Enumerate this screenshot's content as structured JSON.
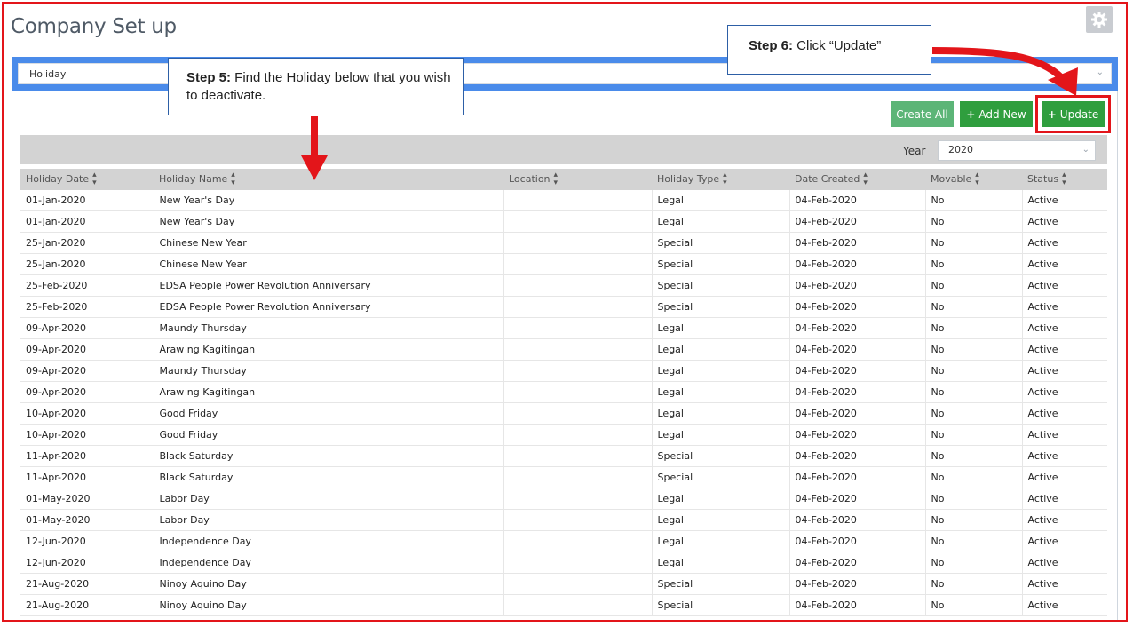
{
  "page": {
    "title": "Company Set up"
  },
  "module_select": {
    "value": "Holiday"
  },
  "toolbar": {
    "create_all": "Create All",
    "add_new": "Add New",
    "update": "Update"
  },
  "filter": {
    "year_label": "Year",
    "year_value": "2020"
  },
  "table": {
    "headers": [
      "Holiday Date",
      "Holiday Name",
      "Location",
      "Holiday Type",
      "Date Created",
      "Movable",
      "Status"
    ],
    "rows": [
      [
        "01-Jan-2020",
        "New Year's Day",
        "",
        "Legal",
        "04-Feb-2020",
        "No",
        "Active"
      ],
      [
        "01-Jan-2020",
        "New Year's Day",
        "",
        "Legal",
        "04-Feb-2020",
        "No",
        "Active"
      ],
      [
        "25-Jan-2020",
        "Chinese New Year",
        "",
        "Special",
        "04-Feb-2020",
        "No",
        "Active"
      ],
      [
        "25-Jan-2020",
        "Chinese New Year",
        "",
        "Special",
        "04-Feb-2020",
        "No",
        "Active"
      ],
      [
        "25-Feb-2020",
        "EDSA People Power Revolution Anniversary",
        "",
        "Special",
        "04-Feb-2020",
        "No",
        "Active"
      ],
      [
        "25-Feb-2020",
        "EDSA People Power Revolution Anniversary",
        "",
        "Special",
        "04-Feb-2020",
        "No",
        "Active"
      ],
      [
        "09-Apr-2020",
        "Maundy Thursday",
        "",
        "Legal",
        "04-Feb-2020",
        "No",
        "Active"
      ],
      [
        "09-Apr-2020",
        "Araw ng Kagitingan",
        "",
        "Legal",
        "04-Feb-2020",
        "No",
        "Active"
      ],
      [
        "09-Apr-2020",
        "Maundy Thursday",
        "",
        "Legal",
        "04-Feb-2020",
        "No",
        "Active"
      ],
      [
        "09-Apr-2020",
        "Araw ng Kagitingan",
        "",
        "Legal",
        "04-Feb-2020",
        "No",
        "Active"
      ],
      [
        "10-Apr-2020",
        "Good Friday",
        "",
        "Legal",
        "04-Feb-2020",
        "No",
        "Active"
      ],
      [
        "10-Apr-2020",
        "Good Friday",
        "",
        "Legal",
        "04-Feb-2020",
        "No",
        "Active"
      ],
      [
        "11-Apr-2020",
        "Black Saturday",
        "",
        "Special",
        "04-Feb-2020",
        "No",
        "Active"
      ],
      [
        "11-Apr-2020",
        "Black Saturday",
        "",
        "Special",
        "04-Feb-2020",
        "No",
        "Active"
      ],
      [
        "01-May-2020",
        "Labor Day",
        "",
        "Legal",
        "04-Feb-2020",
        "No",
        "Active"
      ],
      [
        "01-May-2020",
        "Labor Day",
        "",
        "Legal",
        "04-Feb-2020",
        "No",
        "Active"
      ],
      [
        "12-Jun-2020",
        "Independence Day",
        "",
        "Legal",
        "04-Feb-2020",
        "No",
        "Active"
      ],
      [
        "12-Jun-2020",
        "Independence Day",
        "",
        "Legal",
        "04-Feb-2020",
        "No",
        "Active"
      ],
      [
        "21-Aug-2020",
        "Ninoy Aquino Day",
        "",
        "Special",
        "04-Feb-2020",
        "No",
        "Active"
      ],
      [
        "21-Aug-2020",
        "Ninoy Aquino Day",
        "",
        "Special",
        "04-Feb-2020",
        "No",
        "Active"
      ]
    ]
  },
  "callouts": {
    "step5_label": "Step 5:",
    "step5_text": " Find the Holiday below that you wish to deactivate.",
    "step6_label": "Step 6:",
    "step6_text": " Click “Update”"
  },
  "colors": {
    "accent_blue": "#4a8bea",
    "button_green": "#2f9e3e",
    "button_green_light": "#5cb577",
    "annotation_red": "#e3151a"
  }
}
